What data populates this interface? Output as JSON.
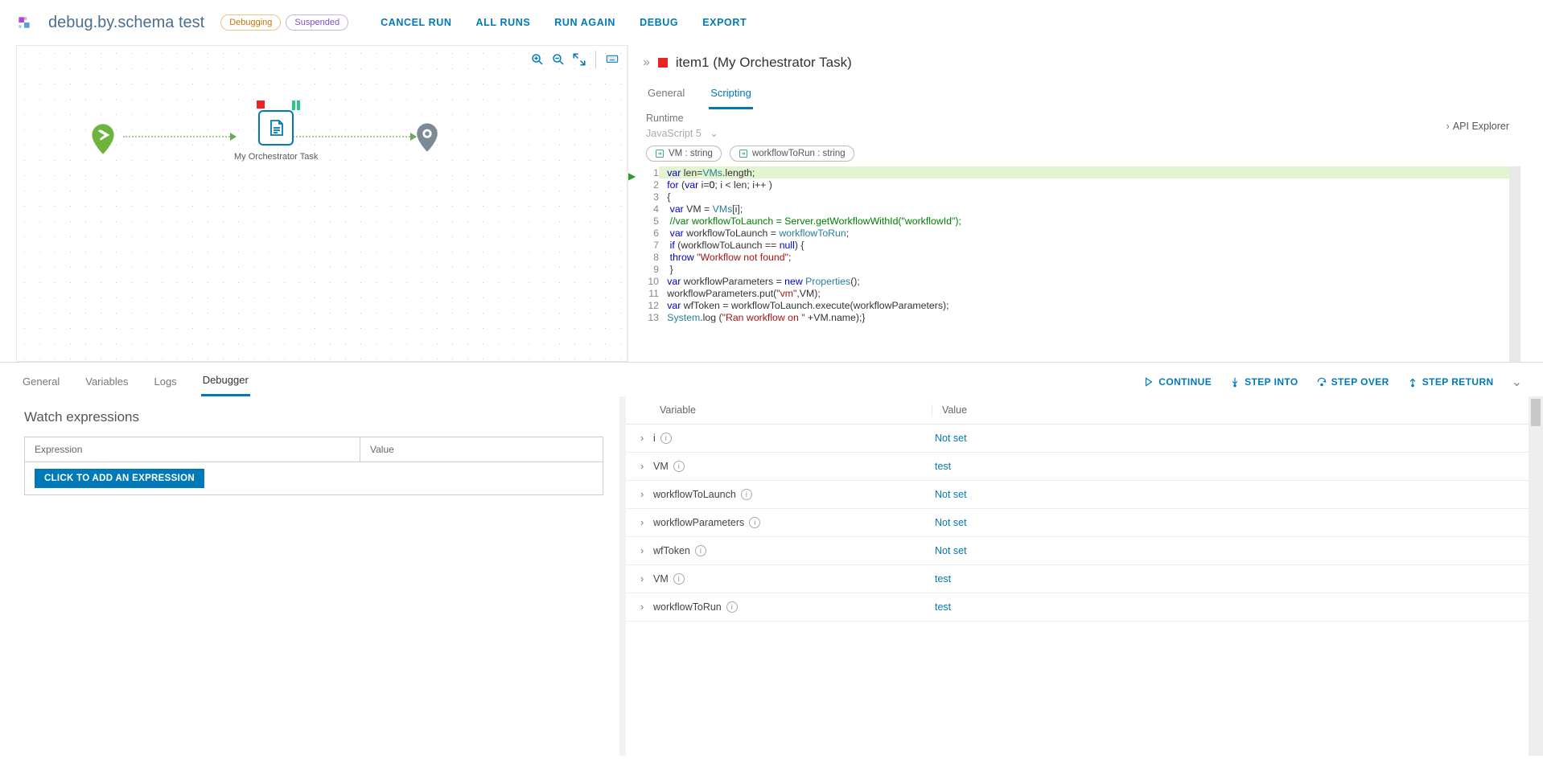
{
  "header": {
    "workflow_name": "debug.by.schema test",
    "badge_debugging": "Debugging",
    "badge_suspended": "Suspended",
    "links": {
      "cancel": "CANCEL RUN",
      "all_runs": "ALL RUNS",
      "run_again": "RUN AGAIN",
      "debug": "DEBUG",
      "export": "EXPORT"
    }
  },
  "canvas": {
    "task_label": "My Orchestrator Task"
  },
  "right_panel": {
    "title": "item1 (My Orchestrator Task)",
    "tabs": {
      "general": "General",
      "scripting": "Scripting"
    },
    "runtime_label": "Runtime",
    "runtime_value": "JavaScript 5",
    "api_explorer": "API Explorer",
    "pills": [
      {
        "label": "VM : string"
      },
      {
        "label": "workflowToRun : string"
      }
    ],
    "code": [
      {
        "n": 1,
        "hl": true
      },
      {
        "n": 2
      },
      {
        "n": 3
      },
      {
        "n": 4
      },
      {
        "n": 5
      },
      {
        "n": 6
      },
      {
        "n": 7
      },
      {
        "n": 8
      },
      {
        "n": 9
      },
      {
        "n": 10
      },
      {
        "n": 11
      },
      {
        "n": 12
      },
      {
        "n": 13
      }
    ]
  },
  "bottom": {
    "tabs": {
      "general": "General",
      "variables": "Variables",
      "logs": "Logs",
      "debugger": "Debugger"
    },
    "actions": {
      "continue": "CONTINUE",
      "into": "STEP INTO",
      "over": "STEP OVER",
      "return": "STEP RETURN"
    },
    "watch": {
      "title": "Watch expressions",
      "col_expression": "Expression",
      "col_value": "Value",
      "add_button": "CLICK TO ADD AN EXPRESSION"
    },
    "vars": {
      "col_variable": "Variable",
      "col_value": "Value",
      "rows": [
        {
          "name": "i",
          "value": "Not set"
        },
        {
          "name": "VM",
          "value": "test"
        },
        {
          "name": "workflowToLaunch",
          "value": "Not set"
        },
        {
          "name": "workflowParameters",
          "value": "Not set"
        },
        {
          "name": "wfToken",
          "value": "Not set"
        },
        {
          "name": "VM",
          "value": "test"
        },
        {
          "name": "workflowToRun",
          "value": "test"
        }
      ]
    }
  }
}
